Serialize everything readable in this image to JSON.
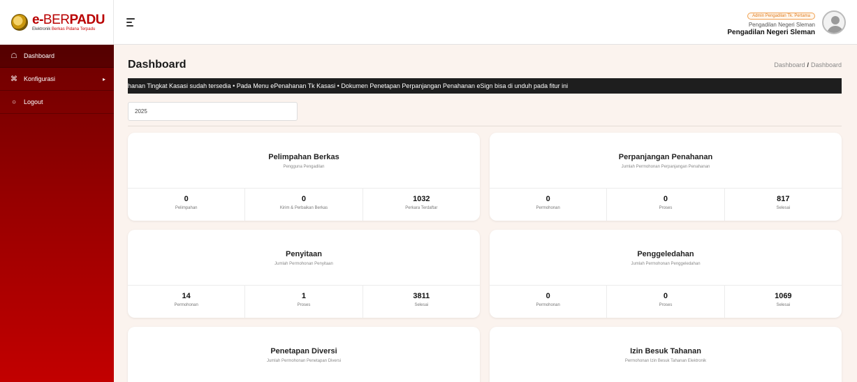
{
  "brand": {
    "title_prefix": "e-",
    "title_light": "BER",
    "title_bold": "PADU",
    "subtitle_a": "Elektronik ",
    "subtitle_b": "Berkas Pidana Terpadu"
  },
  "header": {
    "role_badge": "Admin Pengadilan Tk. Pertama",
    "court_small": "Pengadilan Negeri Sleman",
    "court_name": "Pengadilan Negeri Sleman"
  },
  "sidebar": {
    "items": [
      {
        "label": "Dashboard",
        "icon": "home-icon"
      },
      {
        "label": "Konfigurasi",
        "icon": "command-icon"
      },
      {
        "label": "Logout",
        "icon": "power-icon"
      }
    ]
  },
  "page": {
    "title": "Dashboard",
    "breadcrumb": [
      "Dashboard",
      "Dashboard"
    ],
    "ticker": "hanan Tingkat Kasasi sudah tersedia  •  Pada Menu ePenahanan Tk Kasasi  •  Dokumen Penetapan Perpanjangan Penahanan eSign bisa di unduh pada fitur ini",
    "year_value": "2025"
  },
  "cards": [
    {
      "title": "Pelimpahan Berkas",
      "subtitle": "Pengguna Pengadilan",
      "stats": [
        {
          "value": "0",
          "label": "Pelimpahan"
        },
        {
          "value": "0",
          "label": "Kirim & Perbaikan Berkas"
        },
        {
          "value": "1032",
          "label": "Perkara Terdaftar"
        }
      ]
    },
    {
      "title": "Perpanjangan Penahanan",
      "subtitle": "Jumlah Permohonan Perpanjangan Penahanan",
      "stats": [
        {
          "value": "0",
          "label": "Permohonan"
        },
        {
          "value": "0",
          "label": "Proses"
        },
        {
          "value": "817",
          "label": "Selesai"
        }
      ]
    },
    {
      "title": "Penyitaan",
      "subtitle": "Jumlah Permohonan Penyitaan",
      "stats": [
        {
          "value": "14",
          "label": "Permohonan"
        },
        {
          "value": "1",
          "label": "Proses"
        },
        {
          "value": "3811",
          "label": "Selesai"
        }
      ]
    },
    {
      "title": "Penggeledahan",
      "subtitle": "Jumlah Permohonan Penggeledahan",
      "stats": [
        {
          "value": "0",
          "label": "Permohonan"
        },
        {
          "value": "0",
          "label": "Proses"
        },
        {
          "value": "1069",
          "label": "Selesai"
        }
      ]
    },
    {
      "title": "Penetapan Diversi",
      "subtitle": "Jumlah Permohonan Penetapan Diversi",
      "stats": []
    },
    {
      "title": "Izin Besuk Tahanan",
      "subtitle": "Permohonan Izin Besuk Tahanan Elektronik",
      "stats": []
    }
  ],
  "colors": {
    "accent": "#b90000",
    "sidebar_dark": "#6d0000",
    "sidebar_light": "#c20000",
    "ticker_bg": "#1e1e1e"
  }
}
